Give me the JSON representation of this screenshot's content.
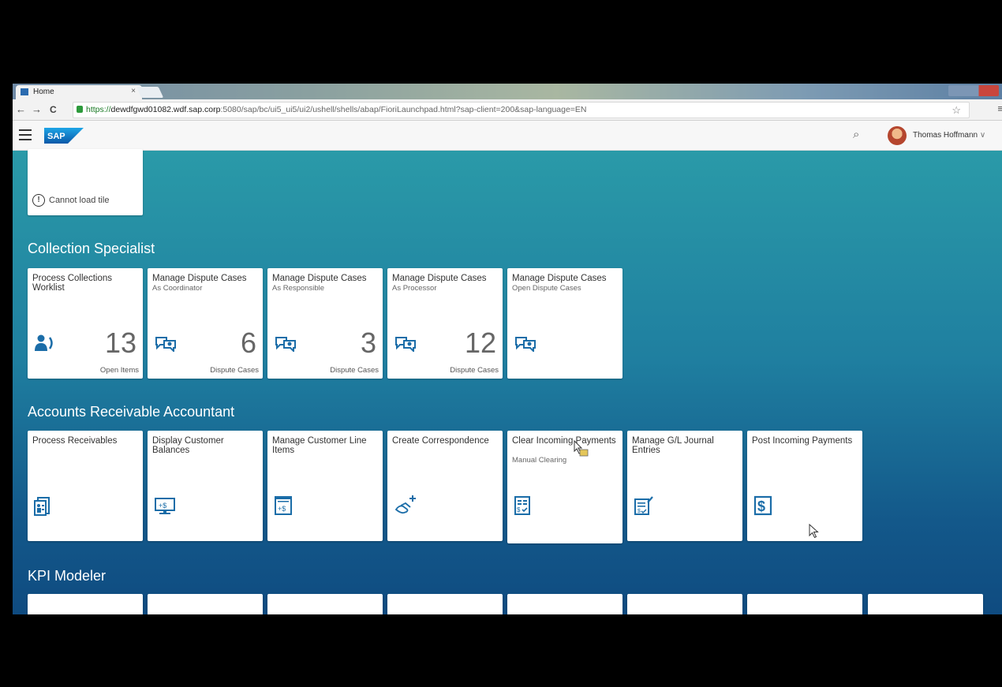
{
  "browser": {
    "tab_title": "Home",
    "tab_close": "×",
    "url_scheme": "https://",
    "url_host": "dewdfgwd01082.wdf.sap.corp",
    "url_rest": ":5080/sap/bc/ui5_ui5/ui2/ushell/shells/abap/FioriLaunchpad.html?sap-client=200&sap-language=EN",
    "back_icon": "←",
    "forward_icon": "→",
    "reload_icon": "C",
    "star_icon": "☆",
    "menu_icon": "≡"
  },
  "shell": {
    "logo": "SAP",
    "search_icon": "⌕",
    "user_name": "Thomas Hoffmann",
    "user_chevron": "∨"
  },
  "top_tile": {
    "error_text": "Cannot load tile",
    "error_icon": "!"
  },
  "groups": {
    "collection": {
      "title": "Collection Specialist",
      "tiles": [
        {
          "title": "Process Collections Worklist",
          "subtitle": "",
          "number": "13",
          "unit": "Open Items",
          "icon": "person-call-icon"
        },
        {
          "title": "Manage Dispute Cases",
          "subtitle": "As Coordinator",
          "number": "6",
          "unit": "Dispute Cases",
          "icon": "dispute-icon"
        },
        {
          "title": "Manage Dispute Cases",
          "subtitle": "As Responsible",
          "number": "3",
          "unit": "Dispute Cases",
          "icon": "dispute-icon"
        },
        {
          "title": "Manage Dispute Cases",
          "subtitle": "As Processor",
          "number": "12",
          "unit": "Dispute Cases",
          "icon": "dispute-icon"
        },
        {
          "title": "Manage Dispute Cases",
          "subtitle": "Open Dispute Cases",
          "number": "",
          "unit": "",
          "icon": "dispute-icon"
        }
      ]
    },
    "ar": {
      "title": "Accounts Receivable Accountant",
      "tiles": [
        {
          "title": "Process Receivables",
          "subtitle": "",
          "icon": "receivables-icon"
        },
        {
          "title": "Display Customer Balances",
          "subtitle": "",
          "icon": "balance-monitor-icon"
        },
        {
          "title": "Manage Customer Line Items",
          "subtitle": "",
          "icon": "line-items-icon"
        },
        {
          "title": "Create Correspondence",
          "subtitle": "",
          "icon": "handshake-icon"
        },
        {
          "title": "Clear Incoming Payments",
          "subtitle": "Manual Clearing",
          "icon": "clearing-document-icon"
        },
        {
          "title": "Manage G/L Journal Entries",
          "subtitle": "",
          "icon": "journal-entry-icon"
        },
        {
          "title": "Post Incoming Payments",
          "subtitle": "",
          "icon": "dollar-icon"
        }
      ]
    },
    "kpi": {
      "title": "KPI Modeler"
    }
  },
  "colors": {
    "accent": "#1b6da8",
    "background_top": "#2a9aa8",
    "background_bottom": "#0f4b80"
  }
}
